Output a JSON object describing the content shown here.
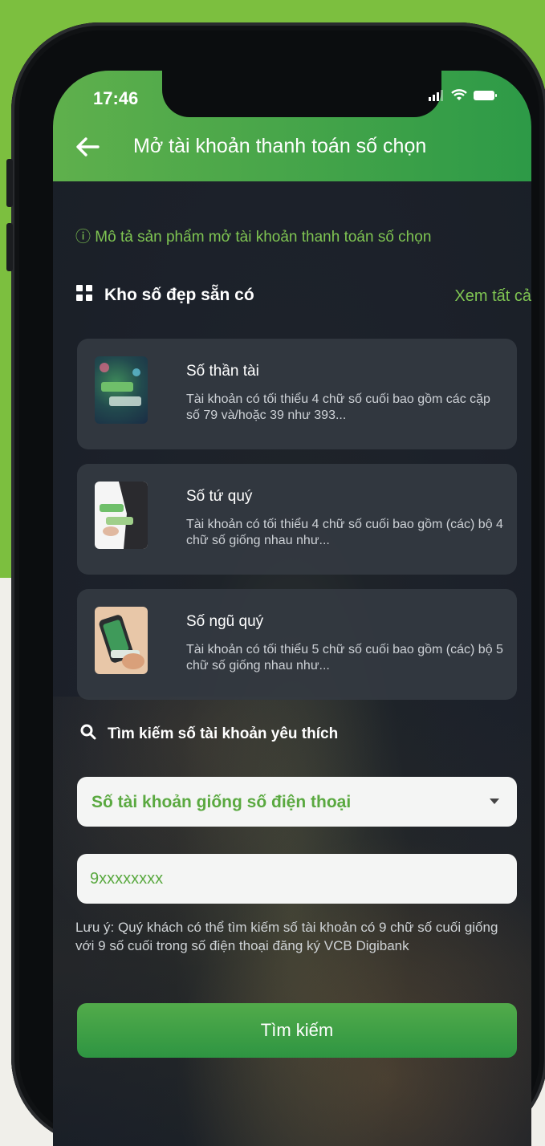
{
  "status": {
    "time": "17:46"
  },
  "header": {
    "title": "Mở tài khoản thanh toán số chọn"
  },
  "description_link": "ⓘ Mô tả sản phẩm mở tài khoản thanh toán số chọn",
  "gallery": {
    "title": "Kho số đẹp sẵn có",
    "see_all": "Xem tất cả",
    "items": [
      {
        "title": "Số thần tài",
        "desc": "Tài khoản có tối thiểu 4 chữ số cuối bao gồm các cặp số 79 và/hoặc 39 như 393..."
      },
      {
        "title": "Số tứ quý",
        "desc": "Tài khoản có tối thiểu 4 chữ số cuối bao gồm (các) bộ 4 chữ số giống nhau như..."
      },
      {
        "title": "Số ngũ quý",
        "desc": "Tài khoản có tối thiểu 5 chữ số cuối bao gồm (các) bộ 5 chữ số giống nhau như..."
      }
    ]
  },
  "search": {
    "title": "Tìm kiếm số tài khoản yêu thích",
    "select_value": "Số tài khoản giống số điện thoại",
    "input_value": "9xxxxxxxx",
    "note": "Lưu ý: Quý khách có thể tìm kiếm số tài khoản có 9 chữ số cuối giống với 9 số cuối trong số điện thoại đăng ký VCB Digibank",
    "button_label": "Tìm kiếm"
  },
  "colors": {
    "brand_green": "#2d9a47",
    "accent_green": "#7fc552",
    "background_green": "#7cbf3f"
  }
}
